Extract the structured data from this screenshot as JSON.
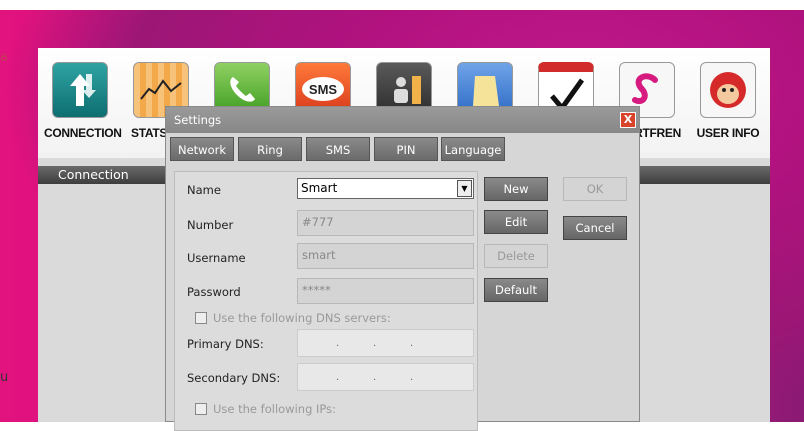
{
  "toolbar": {
    "items": [
      {
        "label": "CONNECTION",
        "icon": "connection-arrows-icon"
      },
      {
        "label": "STATS",
        "icon": "statistics-chart-icon"
      },
      {
        "label": "",
        "icon": "phone-icon"
      },
      {
        "label": "",
        "icon": "sms-icon"
      },
      {
        "label": "",
        "icon": "contacts-icon"
      },
      {
        "label": "",
        "icon": "notes-icon"
      },
      {
        "label": "",
        "icon": "checklist-icon"
      },
      {
        "label": "RTFREN",
        "icon": "smartfren-logo-icon"
      },
      {
        "label": "USER INFO",
        "icon": "monkey-user-icon"
      }
    ]
  },
  "connection_bar": {
    "label": "Connection"
  },
  "dialog": {
    "title": "Settings",
    "close": "X",
    "tabs": [
      "Network",
      "Ring",
      "SMS",
      "PIN",
      "Language"
    ],
    "fields": {
      "name_label": "Name",
      "name_value": "Smart",
      "number_label": "Number",
      "number_value": "#777",
      "username_label": "Username",
      "username_value": "smart",
      "password_label": "Password",
      "password_value": "*****",
      "dns_checkbox_label": "Use the following DNS servers:",
      "primary_dns_label": "Primary DNS:",
      "secondary_dns_label": "Secondary DNS:",
      "ip_checkbox_label": "Use the following IPs:"
    },
    "buttons": {
      "new": "New",
      "edit": "Edit",
      "delete": "Delete",
      "default": "Default",
      "ok": "OK",
      "cancel": "Cancel"
    }
  },
  "desktop": {
    "left_text_top": "a",
    "left_text_bottom": "u"
  }
}
